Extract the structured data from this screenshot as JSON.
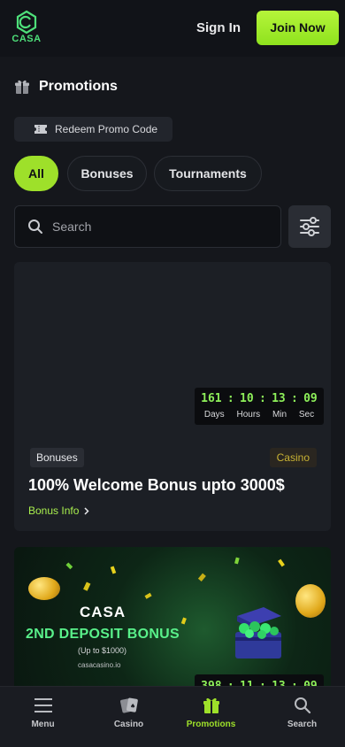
{
  "header": {
    "logo_text": "CASA",
    "signin_label": "Sign In",
    "join_label": "Join Now"
  },
  "page": {
    "title": "Promotions"
  },
  "redeem": {
    "label": "Redeem Promo Code"
  },
  "tabs": [
    {
      "label": "All",
      "active": true
    },
    {
      "label": "Bonuses",
      "active": false
    },
    {
      "label": "Tournaments",
      "active": false
    }
  ],
  "search": {
    "placeholder": "Search"
  },
  "promo_cards": [
    {
      "timer": {
        "values": [
          "161",
          "10",
          "13",
          "09"
        ],
        "labels": [
          "Days",
          "Hours",
          "Min",
          "Sec"
        ]
      },
      "category": "Bonuses",
      "tag": "Casino",
      "title": "100% Welcome Bonus upto 3000$",
      "link_label": "Bonus Info"
    },
    {
      "banner_logo": "CASA",
      "banner_title": "2ND DEPOSIT BONUS",
      "banner_subtitle": "(Up to $1000)",
      "banner_site": "casacasino.io",
      "timer": {
        "values": [
          "398",
          "11",
          "13",
          "09"
        ]
      }
    }
  ],
  "bottom_nav": [
    {
      "label": "Menu",
      "icon": "menu-icon",
      "active": false
    },
    {
      "label": "Casino",
      "icon": "cards-icon",
      "active": false
    },
    {
      "label": "Promotions",
      "icon": "gift-icon",
      "active": true
    },
    {
      "label": "Search",
      "icon": "search-icon",
      "active": false
    }
  ],
  "colors": {
    "accent": "#9ee02a",
    "background": "#15171c",
    "card": "#1c1f25",
    "timer_text": "#8ef05a",
    "casino_tag": "#c8b234"
  }
}
